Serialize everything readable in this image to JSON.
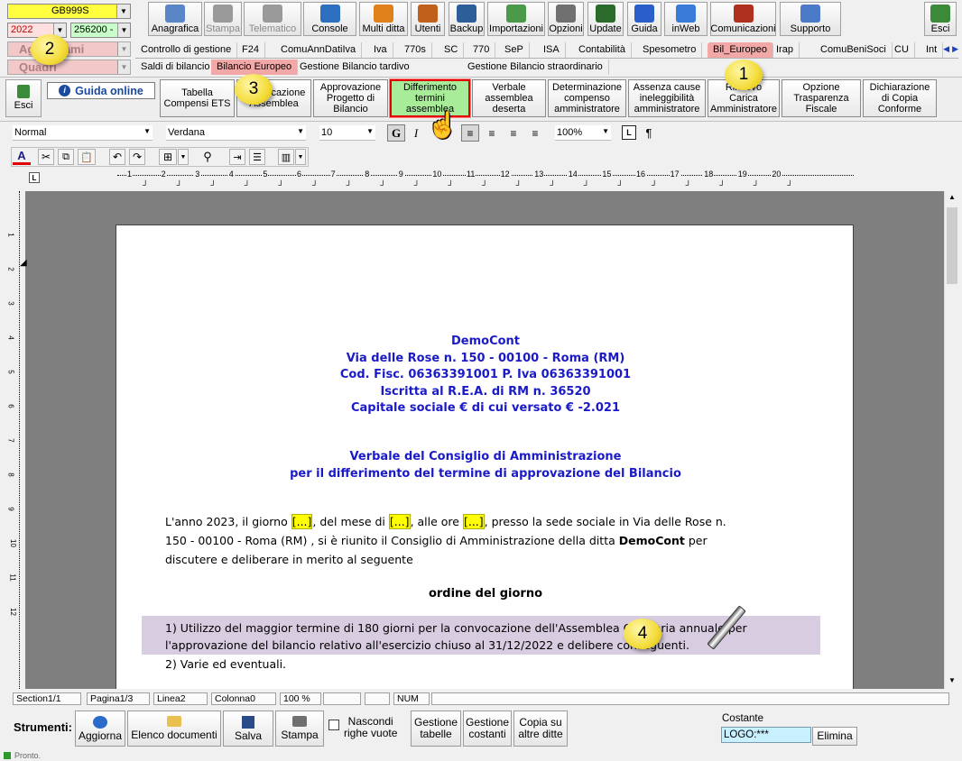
{
  "topleft": {
    "code": "GB999S",
    "year": "2022",
    "ditta": "256200 -",
    "row2": "Aggiornami",
    "row3": "Quadri"
  },
  "toolbar": [
    {
      "label": "Anagrafica",
      "name": "anagrafica",
      "color": "#5a86c8",
      "enabled": true
    },
    {
      "label": "Stampa",
      "name": "stampa",
      "color": "#9a9a9a",
      "enabled": false
    },
    {
      "label": "Telematico",
      "name": "telematico",
      "color": "#9a9a9a",
      "enabled": false
    },
    {
      "label": "Console",
      "name": "console",
      "color": "#2c6fbf",
      "enabled": true
    },
    {
      "label": "Multi ditta",
      "name": "multi-ditta",
      "color": "#e0801a",
      "enabled": true
    },
    {
      "label": "Utenti",
      "name": "utenti",
      "color": "#c0601a",
      "enabled": true
    },
    {
      "label": "Backup",
      "name": "backup",
      "color": "#2d5e9a",
      "enabled": true
    },
    {
      "label": "Importazioni",
      "name": "importazioni",
      "color": "#4a9a4a",
      "enabled": true
    },
    {
      "label": "Opzioni",
      "name": "opzioni",
      "color": "#707070",
      "enabled": true
    },
    {
      "label": "Update",
      "name": "update",
      "color": "#2a6a2a",
      "enabled": true
    },
    {
      "label": "Guida",
      "name": "guida",
      "color": "#2a5ec8",
      "enabled": true
    },
    {
      "label": "inWeb",
      "name": "inweb",
      "color": "#3a7ad8",
      "enabled": true
    },
    {
      "label": "Comunicazioni",
      "name": "comunicazioni",
      "color": "#b03020",
      "enabled": true
    },
    {
      "label": "Supporto",
      "name": "supporto",
      "color": "#4a7ac8",
      "enabled": true
    },
    {
      "label": "Esci",
      "name": "esci",
      "color": "#3a8a3a",
      "enabled": true
    }
  ],
  "tabs1": [
    "Controllo di gestione",
    "F24",
    "ComuAnnDatiIva",
    "Iva",
    "770s",
    "SC",
    "770",
    "SeP",
    "ISA",
    "Contabilità",
    "Spesometro",
    "Bil_Europeo",
    "Irap",
    "ComuBeniSoci",
    "CU",
    "Int"
  ],
  "tabs2": [
    "Saldi di bilancio",
    "Bilancio Europeo",
    "Gestione Bilancio tardivo",
    "Gestione Bilancio straordinario"
  ],
  "ribbon": {
    "esci": "Esci",
    "guida": "Guida online",
    "buttons": [
      "Tabella Compensi ETS",
      "Convocazione Assemblea",
      "Approvazione Progetto di Bilancio",
      "Differimento termini assemblea",
      "Verbale assemblea deserta",
      "Determinazione compenso amministratore",
      "Assenza cause ineleggibilità amministratore",
      "Rinnovo Carica Amministratore",
      "Opzione Trasparenza Fiscale",
      "Dichiarazione di Copia Conforme"
    ]
  },
  "format": {
    "style": "Normal",
    "font": "Verdana",
    "size": "10",
    "bold": "G",
    "italic": "I",
    "zoom": "100%",
    "pilcrow": "¶"
  },
  "ruler": [
    "1",
    "2",
    "3",
    "4",
    "5",
    "6",
    "7",
    "8",
    "9",
    "10",
    "11",
    "12",
    "13",
    "14",
    "15",
    "16",
    "17",
    "18",
    "19",
    "20"
  ],
  "vruler": [
    "1",
    "2",
    "3",
    "4",
    "5",
    "6",
    "7",
    "8",
    "9",
    "10",
    "11",
    "12"
  ],
  "document": {
    "header": [
      "DemoCont",
      "Via delle Rose n. 150 - 00100 - Roma (RM)",
      "Cod. Fisc. 06363391001 P. Iva 06363391001",
      "Iscritta al R.E.A. di RM n. 36520",
      "Capitale sociale €  di cui versato € -2.021"
    ],
    "title": [
      "Verbale del Consiglio di Amministrazione",
      "per il differimento del termine di approvazione del Bilancio"
    ],
    "p1a": "L'anno 2023, il giorno ",
    "ph": "[...]",
    "p1b": ", del mese di ",
    "p1c": ", alle ore ",
    "p1d": ", presso la sede sociale in Via delle Rose n.",
    "p1e": "150 - 00100 - Roma (RM) , si è riunito il Consiglio di Amministrazione della ditta ",
    "company": "DemoCont",
    "p1f": " per",
    "p1g": "discutere e deliberare in merito al seguente",
    "agenda_title": "ordine del giorno",
    "item1a": "1) Utilizzo del maggior termine di 180 giorni per la convocazione dell'Assemblea Ordinaria annuale per",
    "item1b": "l'approvazione del bilancio relativo all'esercizio chiuso al 31/12/2022 e delibere conseguenti.",
    "item2": "2) Varie ed eventuali."
  },
  "callouts": [
    "1",
    "2",
    "3",
    "4"
  ],
  "status": [
    "Section1/1",
    "Pagina1/3",
    "Linea2",
    "Colonna0",
    "100 %",
    "NUM"
  ],
  "bottom": {
    "strumenti": "Strumenti:",
    "aggiorna": "Aggiorna",
    "elenco": "Elenco documenti",
    "salva": "Salva",
    "stampa": "Stampa",
    "nascondi1": "Nascondi",
    "nascondi2": "righe vuote",
    "tabelle1": "Gestione",
    "tabelle2": "tabelle",
    "costanti1": "Gestione",
    "costanti2": "costanti",
    "copia1": "Copia su",
    "copia2": "altre ditte",
    "costante_label": "Costante",
    "costante_value": "LOGO:***",
    "elimina": "Elimina",
    "pronto": "Pronto."
  }
}
